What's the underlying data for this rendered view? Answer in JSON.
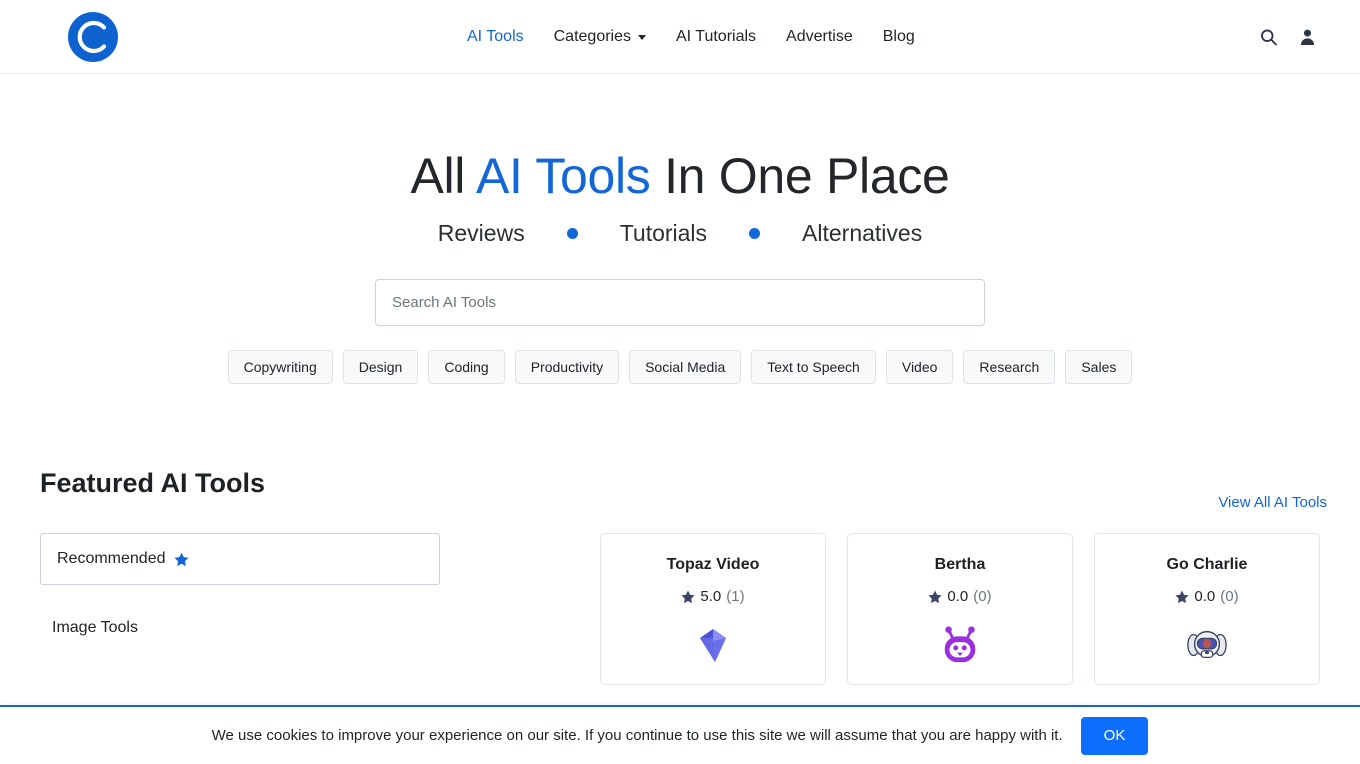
{
  "header": {
    "logo_icon": "circle-c-logo-icon",
    "nav": [
      {
        "label": "AI Tools",
        "active": true
      },
      {
        "label": "Categories",
        "active": false,
        "has_caret": true
      },
      {
        "label": "AI Tutorials",
        "active": false
      },
      {
        "label": "Advertise",
        "active": false
      },
      {
        "label": "Blog",
        "active": false
      }
    ],
    "search_icon": "search-icon",
    "account_icon": "user-icon"
  },
  "hero": {
    "title_before": "All ",
    "title_accent": "AI Tools",
    "title_after": " In One Place",
    "subtitle": [
      "Reviews",
      "Tutorials",
      "Alternatives"
    ]
  },
  "search": {
    "placeholder": "Search AI Tools",
    "value": ""
  },
  "chips": [
    "Copywriting",
    "Design",
    "Coding",
    "Productivity",
    "Social Media",
    "Text to Speech",
    "Video",
    "Research",
    "Sales"
  ],
  "featured": {
    "title": "Featured AI Tools",
    "view_all": "View All AI Tools",
    "sidebar": {
      "recommended_label": "Recommended",
      "recommended_icon": "star-icon",
      "image_tools_label": "Image Tools"
    },
    "cards": [
      {
        "name": "Topaz Video",
        "rating": "5.0",
        "reviews": "(1)",
        "logo_icon": "diamond-logo-icon"
      },
      {
        "name": "Bertha",
        "rating": "0.0",
        "reviews": "(0)",
        "logo_icon": "robot-face-logo-icon"
      },
      {
        "name": "Go Charlie",
        "rating": "0.0",
        "reviews": "(0)",
        "logo_icon": "dog-mascot-logo-icon"
      }
    ]
  },
  "cookie": {
    "text": "We use cookies to improve your experience on our site. If you continue to use this site we will assume that you are happy with it.",
    "ok_label": "OK"
  },
  "colors": {
    "accent_blue": "#1366d6",
    "button_blue": "#0d6efd",
    "text_dark": "#212529",
    "muted": "#6c757d"
  }
}
